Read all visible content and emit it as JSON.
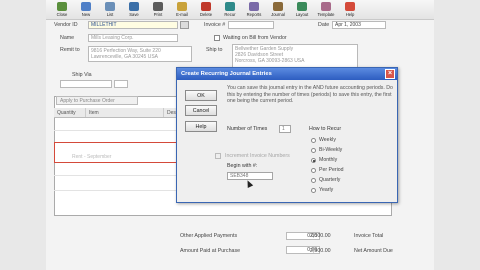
{
  "toolbar": {
    "buttons": [
      {
        "label": "Close",
        "color": "#5a8f3c",
        "icon": "close-icon"
      },
      {
        "label": "New",
        "color": "#4f7fc7",
        "icon": "new-icon"
      },
      {
        "label": "List",
        "color": "#6a8fb8",
        "icon": "list-icon"
      },
      {
        "label": "Save",
        "color": "#3b6fa8",
        "icon": "save-icon"
      },
      {
        "label": "Print",
        "color": "#5c5c5c",
        "icon": "print-icon"
      },
      {
        "label": "E-mail",
        "color": "#c9a23a",
        "icon": "email-icon"
      },
      {
        "label": "Delete",
        "color": "#c0392b",
        "icon": "delete-icon"
      },
      {
        "label": "Recur",
        "color": "#2f8a8a",
        "icon": "recur-icon"
      },
      {
        "label": "Reports",
        "color": "#7a6aa8",
        "icon": "reports-icon"
      },
      {
        "label": "Journal",
        "color": "#8a6a3a",
        "icon": "journal-icon"
      },
      {
        "label": "Layout",
        "color": "#3a8a5a",
        "icon": "layout-icon"
      },
      {
        "label": "Template",
        "color": "#a86a8a",
        "icon": "template-icon"
      },
      {
        "label": "Help",
        "color": "#d44a3a",
        "icon": "help-icon"
      }
    ]
  },
  "form": {
    "vendor_id_label": "Vendor ID",
    "vendor_id_value": "MILLETHIT",
    "invoice_label": "Invoice #",
    "date_label": "Date",
    "date_value": "Apr 1, 2003",
    "waiting_label": "Waiting on Bill from Vendor",
    "name_label": "Name",
    "name_value": "Mills Leasing Corp.",
    "remit_label": "Remit to",
    "remit_value": "9816 Perfection Way, Suite 220\nLawrenceville, GA 30245 USA",
    "ship_label": "Ship to",
    "ship_value": "Bellwether Garden Supply\n2826 Davidson Street\nNorcross, GA 30093-2863 USA",
    "ship_via_label": "Ship Via",
    "apply_tab_label": "Apply to Purchase Order"
  },
  "grid": {
    "headers": [
      "Quantity",
      "Item",
      "Description",
      "GL Account",
      "Unit Price",
      "Amount",
      "Job"
    ],
    "row_text": "Rent - September"
  },
  "totals": {
    "other_label": "Other Applied Payments",
    "other_value": "0.00",
    "invoice_total_label": "Invoice Total",
    "invoice_total_value": "2,500.00",
    "amount_paid_label": "Amount Paid at Purchase",
    "amount_paid_value": "0.00",
    "net_due_label": "Net Amount Due",
    "net_due_value": "2,500.00"
  },
  "dialog": {
    "title": "Create Recurring Journal Entries",
    "ok_label": "OK",
    "cancel_label": "Cancel",
    "help_label": "Help",
    "description": "You can save this journal entry in the AND future accounting periods. Do this by entering the number of times (periods) to save this entry, the first one being the current period.",
    "number_times_label": "Number of Times",
    "number_times_value": "1",
    "increment_label": "Increment Invoice Numbers",
    "begin_label": "Begin with #:",
    "begin_value": "SEB348",
    "how_often_label": "How to Recur",
    "frequencies": [
      "Weekly",
      "Bi-Weekly",
      "Monthly",
      "Per Period",
      "Quarterly",
      "Yearly"
    ],
    "selected_frequency": "Monthly"
  }
}
